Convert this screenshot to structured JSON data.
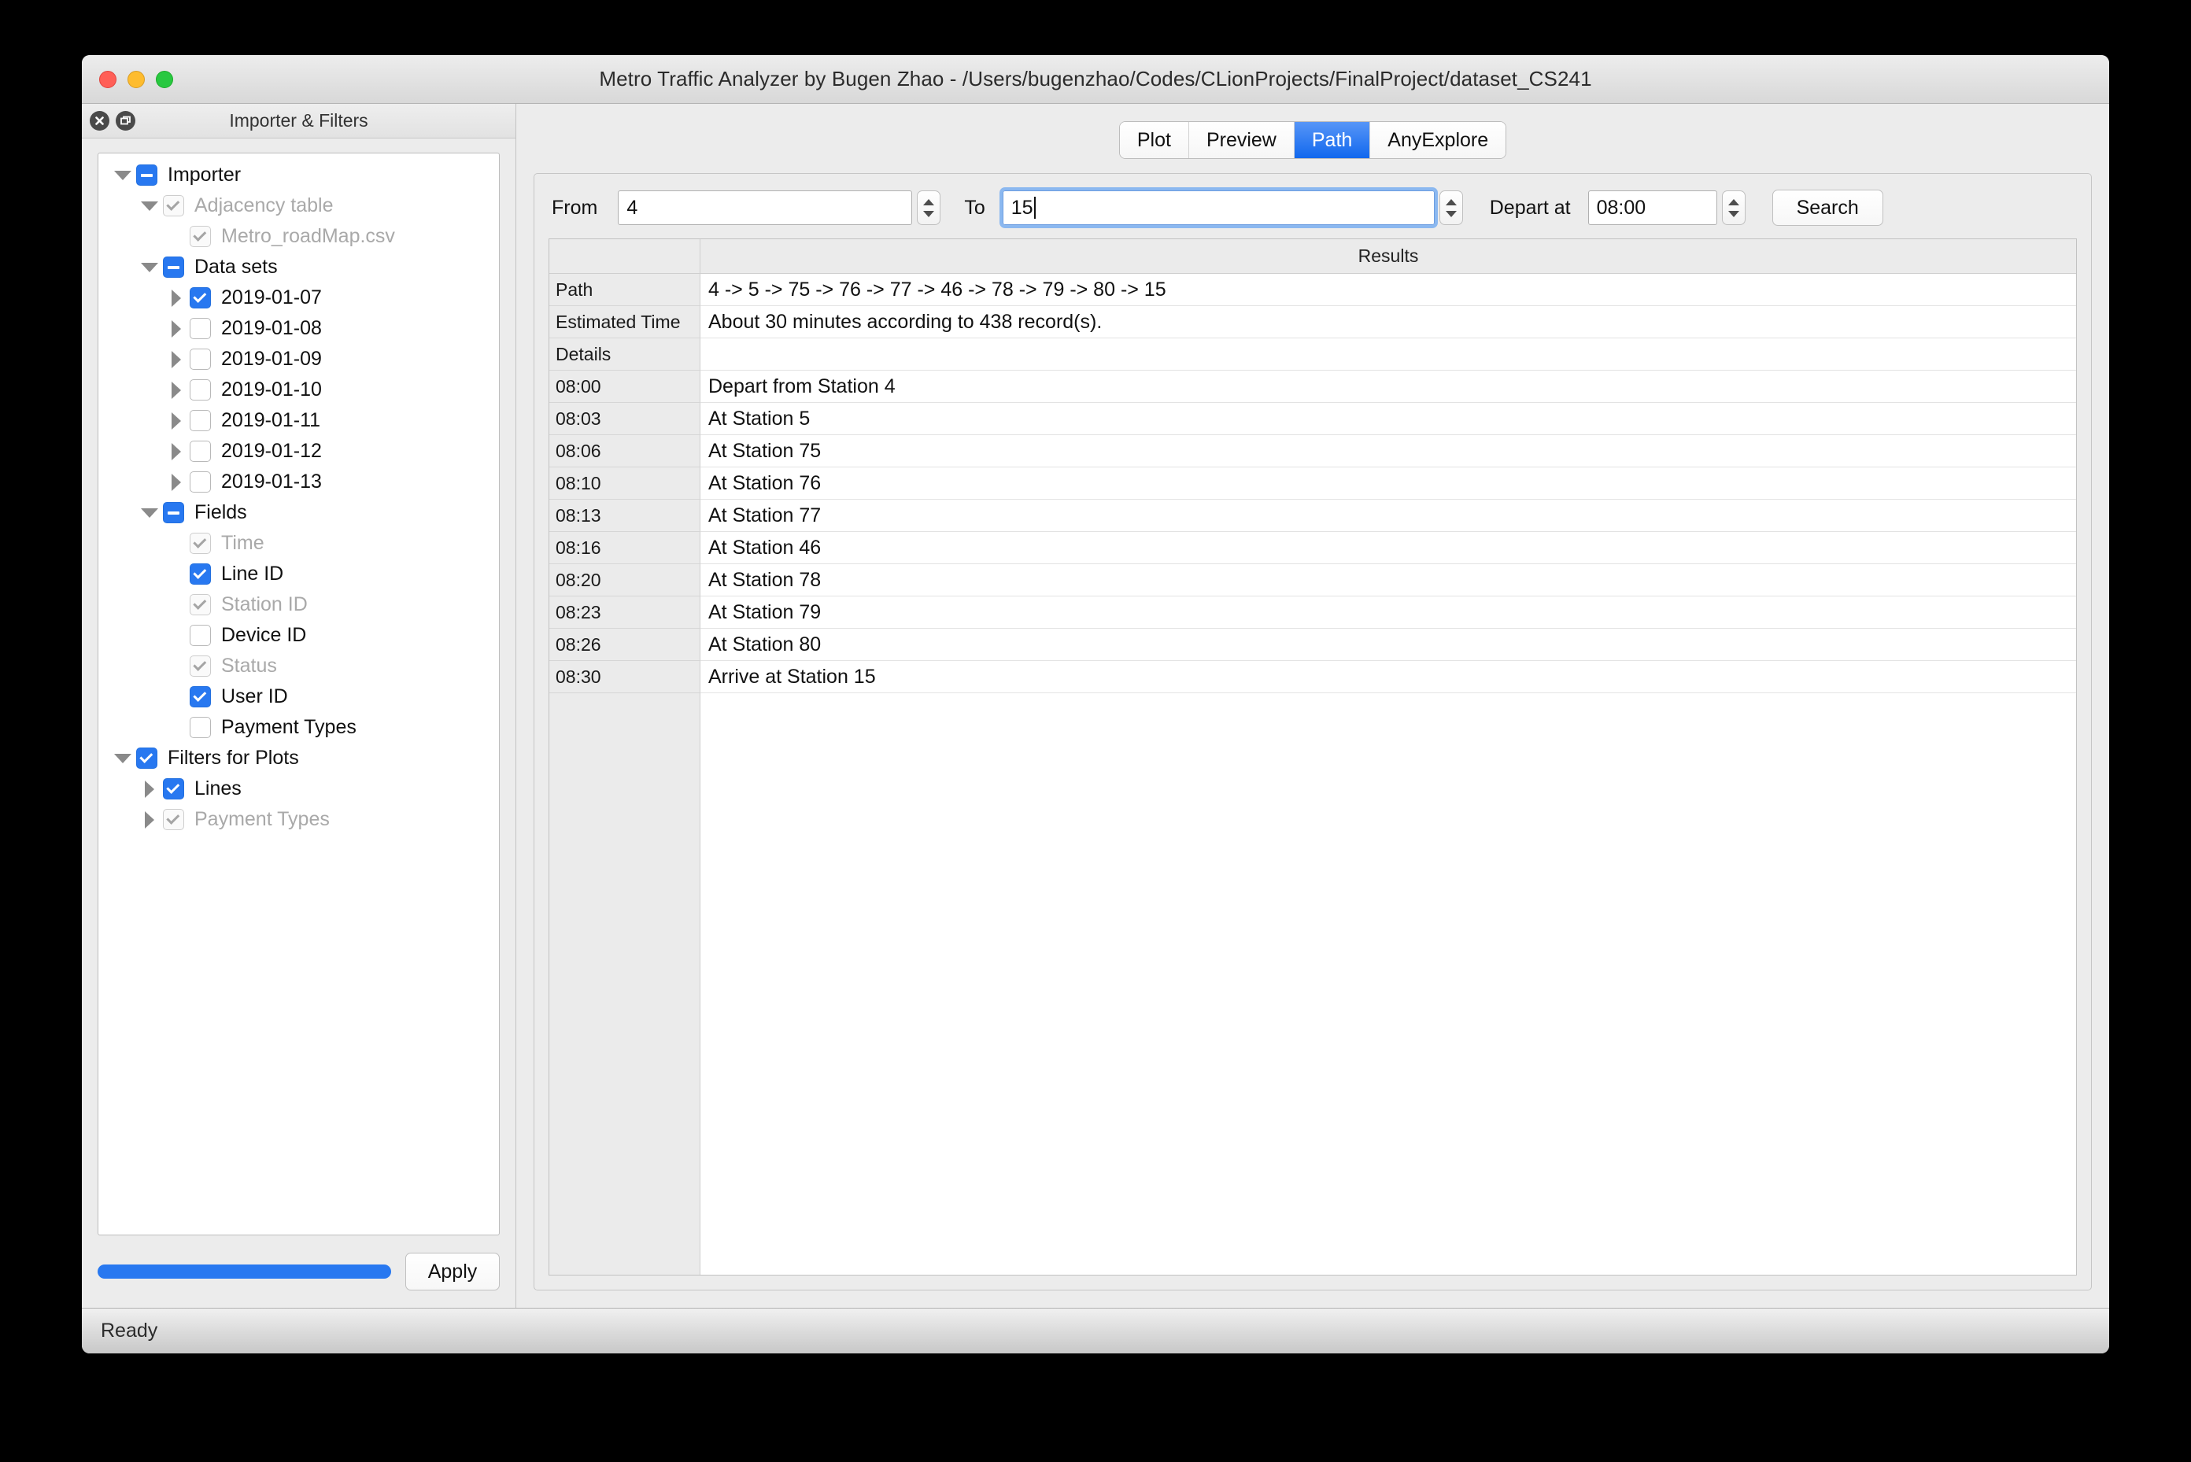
{
  "window": {
    "title": "Metro Traffic Analyzer by Bugen Zhao - /Users/bugenzhao/Codes/CLionProjects/FinalProject/dataset_CS241"
  },
  "sidebar": {
    "dock_title": "Importer & Filters",
    "close_icon": "close-icon",
    "float_icon": "float-icon",
    "tree": [
      {
        "label": "Importer",
        "indent": 0,
        "arrow": "down",
        "check": "partial"
      },
      {
        "label": "Adjacency table",
        "indent": 1,
        "arrow": "down",
        "check": "dim-checked",
        "dim": true
      },
      {
        "label": "Metro_roadMap.csv",
        "indent": 2,
        "arrow": "none",
        "check": "dim-checked",
        "dim": true
      },
      {
        "label": "Data sets",
        "indent": 1,
        "arrow": "down",
        "check": "partial"
      },
      {
        "label": "2019-01-07",
        "indent": 2,
        "arrow": "right",
        "check": "checked"
      },
      {
        "label": "2019-01-08",
        "indent": 2,
        "arrow": "right",
        "check": "unchecked"
      },
      {
        "label": "2019-01-09",
        "indent": 2,
        "arrow": "right",
        "check": "unchecked"
      },
      {
        "label": "2019-01-10",
        "indent": 2,
        "arrow": "right",
        "check": "unchecked"
      },
      {
        "label": "2019-01-11",
        "indent": 2,
        "arrow": "right",
        "check": "unchecked"
      },
      {
        "label": "2019-01-12",
        "indent": 2,
        "arrow": "right",
        "check": "unchecked"
      },
      {
        "label": "2019-01-13",
        "indent": 2,
        "arrow": "right",
        "check": "unchecked"
      },
      {
        "label": "Fields",
        "indent": 1,
        "arrow": "down",
        "check": "partial"
      },
      {
        "label": "Time",
        "indent": 2,
        "arrow": "none",
        "check": "dim-checked",
        "dim": true
      },
      {
        "label": "Line ID",
        "indent": 2,
        "arrow": "none",
        "check": "checked"
      },
      {
        "label": "Station ID",
        "indent": 2,
        "arrow": "none",
        "check": "dim-checked",
        "dim": true
      },
      {
        "label": "Device ID",
        "indent": 2,
        "arrow": "none",
        "check": "unchecked"
      },
      {
        "label": "Status",
        "indent": 2,
        "arrow": "none",
        "check": "dim-checked",
        "dim": true
      },
      {
        "label": "User ID",
        "indent": 2,
        "arrow": "none",
        "check": "checked"
      },
      {
        "label": "Payment Types",
        "indent": 2,
        "arrow": "none",
        "check": "unchecked"
      },
      {
        "label": "Filters for Plots",
        "indent": 0,
        "arrow": "down",
        "check": "checked"
      },
      {
        "label": "Lines",
        "indent": 1,
        "arrow": "right",
        "check": "checked"
      },
      {
        "label": "Payment Types",
        "indent": 1,
        "arrow": "right",
        "check": "dim-checked",
        "dim": true
      }
    ],
    "progress_percent": 100,
    "apply_label": "Apply"
  },
  "tabs": [
    {
      "label": "Plot",
      "active": false
    },
    {
      "label": "Preview",
      "active": false
    },
    {
      "label": "Path",
      "active": true
    },
    {
      "label": "AnyExplore",
      "active": false
    }
  ],
  "search": {
    "from_label": "From",
    "from_value": "4",
    "to_label": "To",
    "to_value": "15",
    "depart_label": "Depart at",
    "depart_value": "08:00",
    "search_label": "Search"
  },
  "results": {
    "header": "Results",
    "summary": [
      {
        "key": "Path",
        "value": "4 -> 5 -> 75 -> 76 -> 77 -> 46 -> 78 -> 79 -> 80 -> 15"
      },
      {
        "key": "Estimated Time",
        "value": "About 30 minutes according to 438 record(s)."
      },
      {
        "key": "Details",
        "value": ""
      }
    ],
    "steps": [
      {
        "key": "08:00",
        "value": "Depart from Station 4"
      },
      {
        "key": "08:03",
        "value": "At Station 5"
      },
      {
        "key": "08:06",
        "value": "At Station 75"
      },
      {
        "key": "08:10",
        "value": "At Station 76"
      },
      {
        "key": "08:13",
        "value": "At Station 77"
      },
      {
        "key": "08:16",
        "value": "At Station 46"
      },
      {
        "key": "08:20",
        "value": "At Station 78"
      },
      {
        "key": "08:23",
        "value": "At Station 79"
      },
      {
        "key": "08:26",
        "value": "At Station 80"
      },
      {
        "key": "08:30",
        "value": "Arrive at Station 15"
      }
    ]
  },
  "statusbar": {
    "text": "Ready"
  },
  "colors": {
    "accent_blue": "#2878f0",
    "tab_active_top": "#5796f7",
    "tab_active_bottom": "#1168ee",
    "focus_ring": "#8bb8f0"
  }
}
